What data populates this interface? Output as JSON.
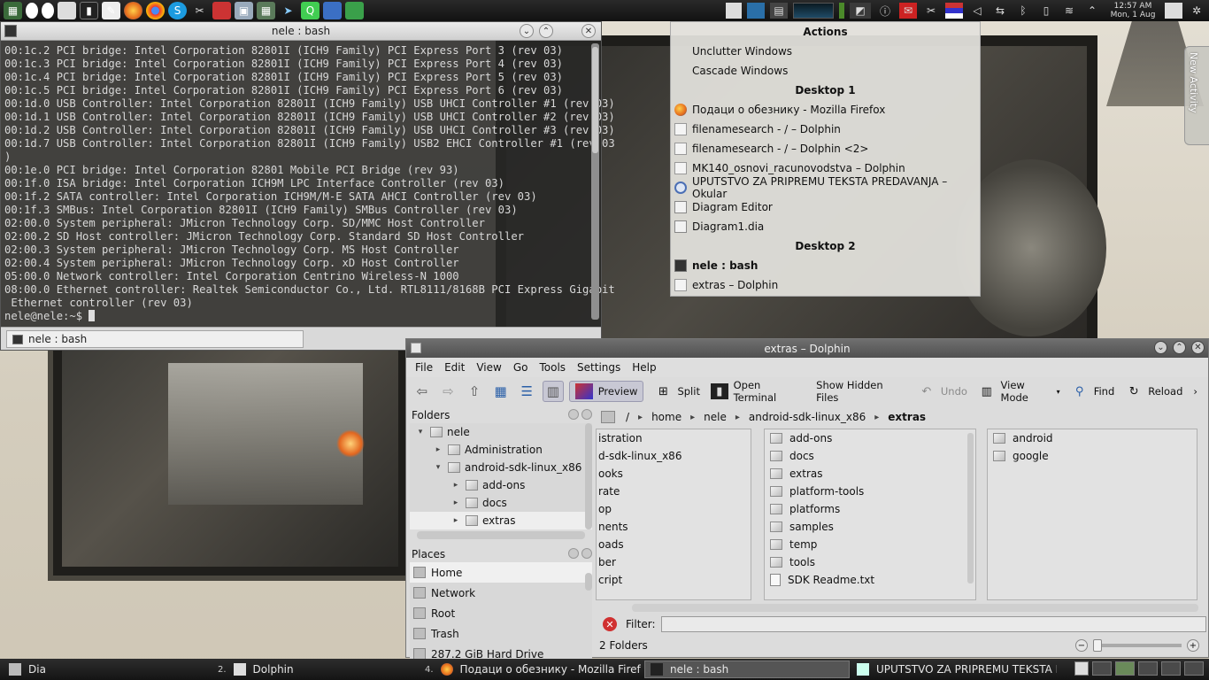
{
  "top_panel": {
    "launchers": [
      "calc-icon",
      "eyes-icon",
      "eyes-icon",
      "book-icon",
      "terminal-icon",
      "editor-icon",
      "firefox-icon",
      "chrome-icon",
      "skype-icon",
      "tools-icon",
      "pdf-icon",
      "box-icon",
      "calculator-icon",
      "bird-icon",
      "qt-icon",
      "doc-icon",
      "sheet-icon"
    ],
    "clock_time": "12:57 AM",
    "clock_date": "Mon, 1 Aug"
  },
  "konsole": {
    "title": "nele : bash",
    "lines": [
      "00:1c.2 PCI bridge: Intel Corporation 82801I (ICH9 Family) PCI Express Port 3 (rev 03)",
      "00:1c.3 PCI bridge: Intel Corporation 82801I (ICH9 Family) PCI Express Port 4 (rev 03)",
      "00:1c.4 PCI bridge: Intel Corporation 82801I (ICH9 Family) PCI Express Port 5 (rev 03)",
      "00:1c.5 PCI bridge: Intel Corporation 82801I (ICH9 Family) PCI Express Port 6 (rev 03)",
      "00:1d.0 USB Controller: Intel Corporation 82801I (ICH9 Family) USB UHCI Controller #1 (rev 03)",
      "00:1d.1 USB Controller: Intel Corporation 82801I (ICH9 Family) USB UHCI Controller #2 (rev 03)",
      "00:1d.2 USB Controller: Intel Corporation 82801I (ICH9 Family) USB UHCI Controller #3 (rev 03)",
      "00:1d.7 USB Controller: Intel Corporation 82801I (ICH9 Family) USB2 EHCI Controller #1 (rev 03",
      ")",
      "00:1e.0 PCI bridge: Intel Corporation 82801 Mobile PCI Bridge (rev 93)",
      "00:1f.0 ISA bridge: Intel Corporation ICH9M LPC Interface Controller (rev 03)",
      "00:1f.2 SATA controller: Intel Corporation ICH9M/M-E SATA AHCI Controller (rev 03)",
      "00:1f.3 SMBus: Intel Corporation 82801I (ICH9 Family) SMBus Controller (rev 03)",
      "02:00.0 System peripheral: JMicron Technology Corp. SD/MMC Host Controller",
      "02:00.2 SD Host controller: JMicron Technology Corp. Standard SD Host Controller",
      "02:00.3 System peripheral: JMicron Technology Corp. MS Host Controller",
      "02:00.4 System peripheral: JMicron Technology Corp. xD Host Controller",
      "05:00.0 Network controller: Intel Corporation Centrino Wireless-N 1000",
      "08:00.0 Ethernet controller: Realtek Semiconductor Co., Ltd. RTL8111/8168B PCI Express Gigabit",
      " Ethernet controller (rev 03)"
    ],
    "prompt": "nele@nele:~$ ",
    "tab_label": "nele : bash"
  },
  "actions": {
    "header": "Actions",
    "items": [
      "Unclutter Windows",
      "Cascade Windows"
    ],
    "desktop1": "Desktop 1",
    "desktop1_windows": [
      {
        "label": "Подаци о обезнику - Mozilla Firefox",
        "icon": "firefox-icon"
      },
      {
        "label": "filenamesearch - / – Dolphin",
        "icon": "dolphin-icon"
      },
      {
        "label": "filenamesearch - / – Dolphin <2>",
        "icon": "dolphin-icon"
      },
      {
        "label": "MK140_osnovi_racunovodstva – Dolphin",
        "icon": "dolphin-icon"
      },
      {
        "label": "UPUTSTVO ZA PRIPREMU TEKSTA PREDAVANJA – Okular",
        "icon": "okular-icon"
      },
      {
        "label": "Diagram Editor",
        "icon": "dia-icon"
      },
      {
        "label": "Diagram1.dia",
        "icon": "dia-icon"
      }
    ],
    "desktop2": "Desktop 2",
    "desktop2_windows": [
      {
        "label": "nele : bash",
        "icon": "terminal-icon"
      },
      {
        "label": "extras – Dolphin",
        "icon": "dolphin-icon"
      }
    ]
  },
  "dolphin": {
    "title": "extras – Dolphin",
    "menu": [
      "File",
      "Edit",
      "View",
      "Go",
      "Tools",
      "Settings",
      "Help"
    ],
    "toolbar": {
      "preview": "Preview",
      "split": "Split",
      "open_terminal": "Open Terminal",
      "show_hidden": "Show Hidden Files",
      "undo": "Undo",
      "view_mode": "View Mode",
      "find": "Find",
      "reload": "Reload"
    },
    "folders_title": "Folders",
    "tree": [
      {
        "label": "nele",
        "indent": 0,
        "arrow": "▾"
      },
      {
        "label": "Administration",
        "indent": 1,
        "arrow": "▸"
      },
      {
        "label": "android-sdk-linux_x86",
        "indent": 1,
        "arrow": "▾"
      },
      {
        "label": "add-ons",
        "indent": 2,
        "arrow": "▸"
      },
      {
        "label": "docs",
        "indent": 2,
        "arrow": "▸"
      },
      {
        "label": "extras",
        "indent": 2,
        "arrow": "▸"
      }
    ],
    "places_title": "Places",
    "places": [
      "Home",
      "Network",
      "Root",
      "Trash",
      "287.2 GiB Hard Drive"
    ],
    "breadcrumb": [
      "/",
      "home",
      "nele",
      "android-sdk-linux_x86",
      "extras"
    ],
    "col1": [
      "istration",
      "d-sdk-linux_x86",
      "ooks",
      "rate",
      "op",
      "nents",
      "oads",
      "ber",
      "cript"
    ],
    "col2": [
      "add-ons",
      "docs",
      "extras",
      "platform-tools",
      "platforms",
      "samples",
      "temp",
      "tools"
    ],
    "col2_file": "SDK Readme.txt",
    "col3": [
      "android",
      "google"
    ],
    "filter_label": "Filter:",
    "status": "2 Folders"
  },
  "activity_tab": "New Activity",
  "taskbar": {
    "tasks": [
      {
        "label": "Dia",
        "num": "",
        "icon": "dia-icon"
      },
      {
        "label": "Dolphin",
        "num": "2.",
        "icon": "dolphin-icon"
      },
      {
        "label": "Подаци о обезнику - Mozilla Firef",
        "num": "4.",
        "icon": "firefox-icon"
      },
      {
        "label": "nele : bash",
        "num": "",
        "icon": "terminal-icon"
      },
      {
        "label": "UPUTSTVO ZA PRIPREMU TEKSTA P",
        "num": "",
        "icon": "okular-icon"
      }
    ]
  }
}
